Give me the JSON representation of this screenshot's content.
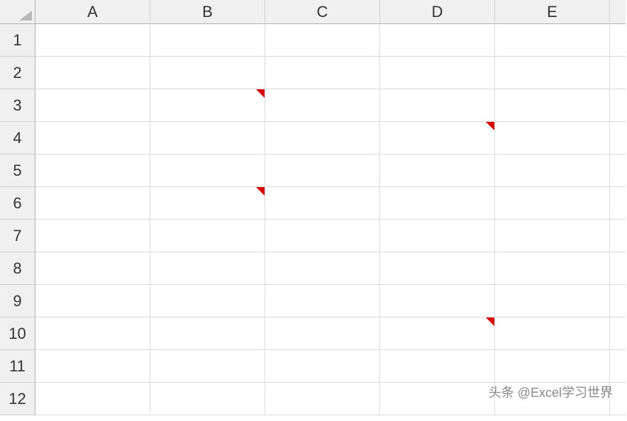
{
  "columns": [
    "A",
    "B",
    "C",
    "D",
    "E"
  ],
  "rows": [
    "1",
    "2",
    "3",
    "4",
    "5",
    "6",
    "7",
    "8",
    "9",
    "10",
    "11",
    "12"
  ],
  "comments": [
    {
      "col": "B",
      "row": "3"
    },
    {
      "col": "D",
      "row": "4"
    },
    {
      "col": "B",
      "row": "6"
    },
    {
      "col": "D",
      "row": "10"
    }
  ],
  "watermark": "头条 @Excel学习世界"
}
